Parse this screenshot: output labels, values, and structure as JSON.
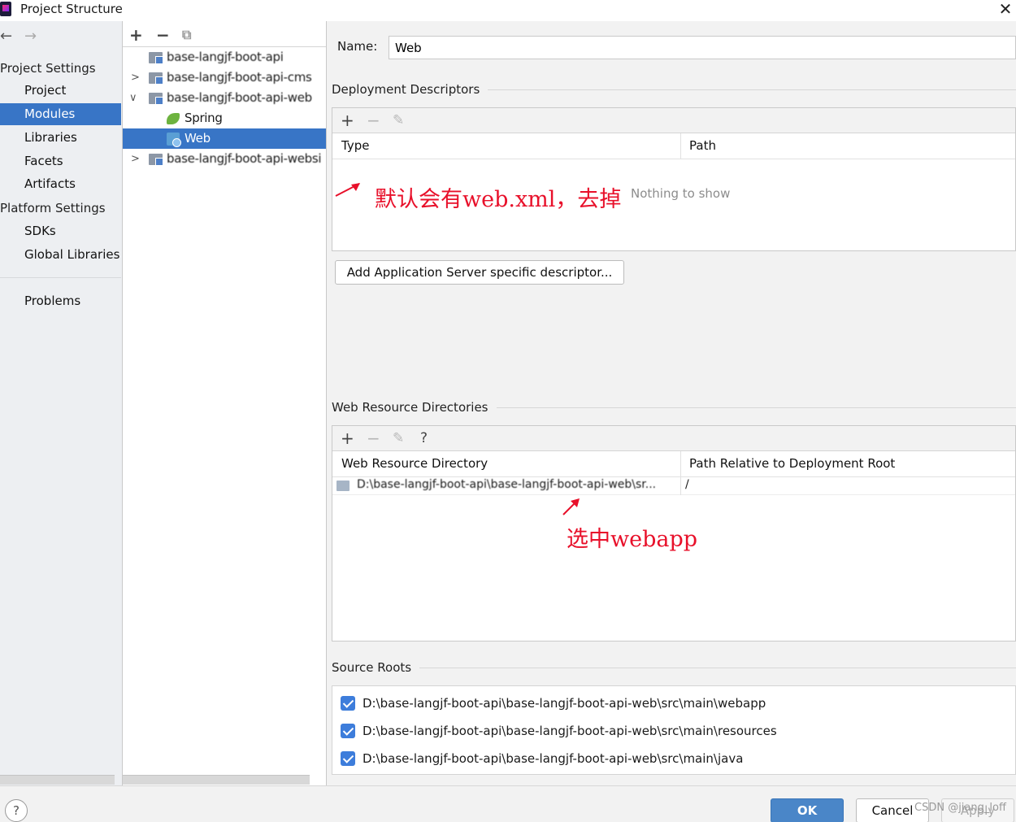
{
  "window": {
    "title": "Project Structure"
  },
  "left_nav": {
    "project_settings_header": "Project Settings",
    "project_items": [
      "Project",
      "Modules",
      "Libraries",
      "Facets",
      "Artifacts"
    ],
    "platform_settings_header": "Platform Settings",
    "platform_items": [
      "SDKs",
      "Global Libraries"
    ],
    "problems": "Problems",
    "selected": "Modules"
  },
  "tree": {
    "rows": [
      {
        "label": "base-langjf-boot-api",
        "obscured": true
      },
      {
        "label": "base-langjf-boot-api-cms",
        "obscured": true
      },
      {
        "label": "base-langjf-boot-api-web",
        "obscured": true
      },
      {
        "label": "Spring",
        "obscured": false
      },
      {
        "label": "Web",
        "obscured": false
      },
      {
        "label": "base-langjf-boot-api-websi",
        "obscured": true
      }
    ],
    "selected": "Web"
  },
  "form": {
    "name_label": "Name:",
    "name_value": "Web"
  },
  "deployment": {
    "title": "Deployment Descriptors",
    "columns": [
      "Type",
      "Path"
    ],
    "empty_text": "Nothing to show",
    "add_button": "Add Application Server specific descriptor..."
  },
  "web_resources": {
    "title": "Web Resource Directories",
    "columns": [
      "Web Resource Directory",
      "Path Relative to Deployment Root"
    ],
    "row": {
      "directory": "D:\\base-langjf-boot-api\\base-langjf-boot-api-web\\sr...",
      "relative_path": "/"
    }
  },
  "source_roots": {
    "title": "Source Roots",
    "items": [
      "D:\\base-langjf-boot-api\\base-langjf-boot-api-web\\src\\main\\webapp",
      "D:\\base-langjf-boot-api\\base-langjf-boot-api-web\\src\\main\\resources",
      "D:\\base-langjf-boot-api\\base-langjf-boot-api-web\\src\\main\\java"
    ]
  },
  "annotations": {
    "deployment_note": "默认会有web.xml，去掉",
    "webapp_note": "选中webapp"
  },
  "buttons": {
    "ok": "OK",
    "cancel": "Cancel",
    "apply": "Apply",
    "help": "?"
  },
  "watermark": "CSDN @jiang_loff",
  "colors": {
    "selection": "#3875c6",
    "annotation": "#e8102a",
    "checkbox": "#3d7ddb",
    "ok_button": "#4a86c8"
  }
}
